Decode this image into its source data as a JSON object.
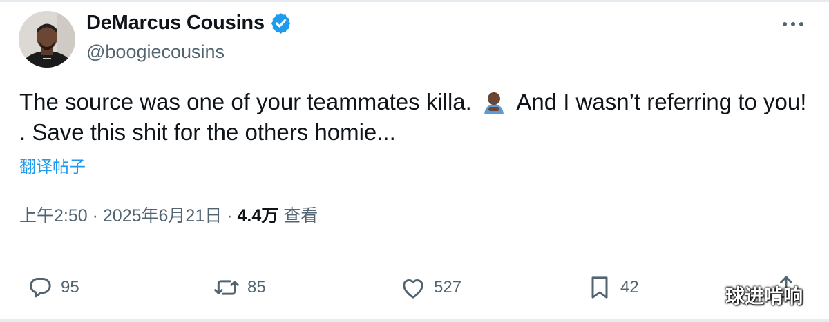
{
  "author": {
    "display_name": "DeMarcus Cousins",
    "handle": "@boogiecousins",
    "verified": true
  },
  "tweet": {
    "text_part1": "The source was one of your teammates killa.",
    "text_part2": "And I wasn’t referring to you! . Save this shit for the others homie...",
    "emoji": "man-bowing-emoji"
  },
  "translate_link": "翻译帖子",
  "meta": {
    "time": "上午2:50",
    "separator": "·",
    "date": "2025年6月21日",
    "views_count": "4.4万",
    "views_label": "查看"
  },
  "actions": {
    "replies": "95",
    "retweets": "85",
    "likes": "527",
    "bookmarks": "42"
  },
  "watermark": "球进啃响",
  "colors": {
    "accent": "#1d9bf0",
    "text": "#0f1419",
    "secondary": "#536471"
  }
}
